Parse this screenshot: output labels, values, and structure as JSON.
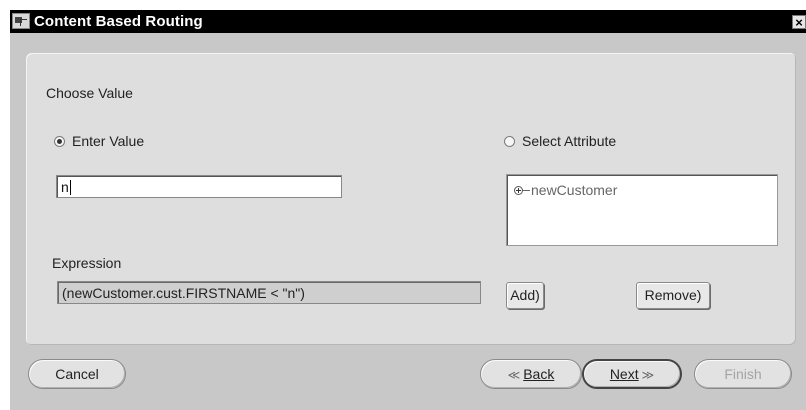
{
  "window": {
    "title": "Content Based Routing",
    "close_glyph": "×"
  },
  "panel": {
    "section_label": "Choose Value",
    "enter_value": {
      "label": "Enter Value",
      "selected": true
    },
    "select_attribute": {
      "label": "Select Attribute",
      "selected": false
    },
    "value_input": {
      "value": "n"
    },
    "tree": {
      "root_label": "newCustomer",
      "expanded": false
    },
    "expression": {
      "label": "Expression",
      "value": "(newCustomer.cust.FIRSTNAME < \"n\")"
    },
    "add_button": "Add)",
    "remove_button": "Remove)"
  },
  "footer": {
    "cancel": "Cancel",
    "back": "Back",
    "back_glyph": "≪",
    "next": "Next",
    "next_glyph": "≫",
    "finish": "Finish"
  }
}
